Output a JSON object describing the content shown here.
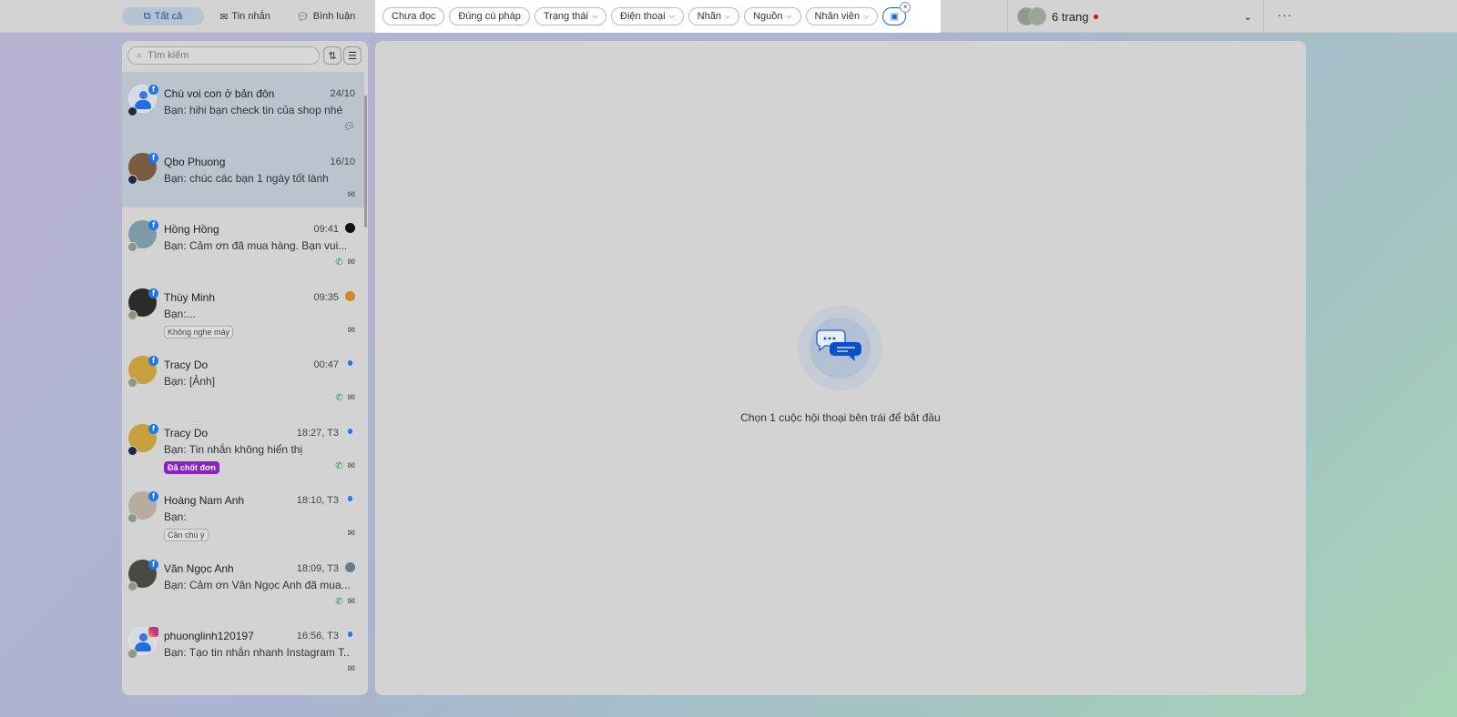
{
  "tabs": [
    {
      "label": "Tất cả",
      "icon": "chat-pages-icon"
    },
    {
      "label": "Tin nhắn",
      "icon": "mail-icon"
    },
    {
      "label": "Bình luận",
      "icon": "comment-icon"
    }
  ],
  "filters": [
    {
      "label": "Chưa đọc",
      "dropdown": false
    },
    {
      "label": "Đúng cú pháp",
      "dropdown": false
    },
    {
      "label": "Trạng thái",
      "dropdown": true
    },
    {
      "label": "Điện thoại",
      "dropdown": true
    },
    {
      "label": "Nhãn",
      "dropdown": true
    },
    {
      "label": "Nguồn",
      "dropdown": true
    },
    {
      "label": "Nhân viên",
      "dropdown": true
    }
  ],
  "pages": {
    "label": "6 trang"
  },
  "search": {
    "placeholder": "Tìm kiếm"
  },
  "conversations": [
    {
      "name": "Chú voi con ở bản đôn",
      "time": "24/10",
      "message": "Bạn: hihi bạn check tin của shop nhé",
      "network": "facebook",
      "selected": true,
      "icons": [
        "comment"
      ]
    },
    {
      "name": "Qbo Phuong",
      "time": "16/10",
      "message": "Bạn: chúc các bạn 1 ngày tốt lành",
      "network": "facebook",
      "selected": true,
      "icons": [
        "mail"
      ]
    },
    {
      "name": "Hồng Hồng",
      "time": "09:41",
      "message": "Bạn: Cảm ơn đã mua hàng. Bạn vui...",
      "network": "facebook",
      "icons": [
        "phone",
        "mail"
      ]
    },
    {
      "name": "Thùy Minh",
      "time": "09:35",
      "message": "Bạn:...",
      "tag": "Không nghe máy",
      "network": "facebook",
      "icons": [
        "mail"
      ]
    },
    {
      "name": "Tracy Do",
      "time": "00:47",
      "message": "Bạn: [Ảnh]",
      "network": "facebook",
      "icons": [
        "phone",
        "mail"
      ]
    },
    {
      "name": "Tracy Do",
      "time": "18:27, T3",
      "message": "Bạn: Tin nhắn không hiển thị",
      "tag": "Đã chốt đơn",
      "tag_color": "#8c1fc7",
      "network": "facebook",
      "icons": [
        "phone",
        "mail"
      ]
    },
    {
      "name": "Hoàng Nam Anh",
      "time": "18:10, T3",
      "message": "Bạn:",
      "tag": "Cần chú ý",
      "network": "facebook",
      "icons": [
        "mail"
      ]
    },
    {
      "name": "Văn Ngọc Anh",
      "time": "18:09, T3",
      "message": "Bạn: Cảm ơn Văn Ngọc Anh đã mua...",
      "network": "facebook",
      "icons": [
        "phone",
        "mail"
      ]
    },
    {
      "name": "phuonglinh120197",
      "time": "16:56, T3",
      "message": "Bạn: Tạo tin nhắn nhanh Instagram T...",
      "network": "instagram",
      "icons": [
        "mail"
      ]
    }
  ],
  "empty_state": {
    "text": "Chọn 1 cuộc hội thoại bên trái để bắt đầu"
  },
  "colors": {
    "accent": "#1f5fd6",
    "facebook": "#1877f2",
    "closed_tag": "#8c1fc7",
    "phone": "#1b9a3c"
  }
}
